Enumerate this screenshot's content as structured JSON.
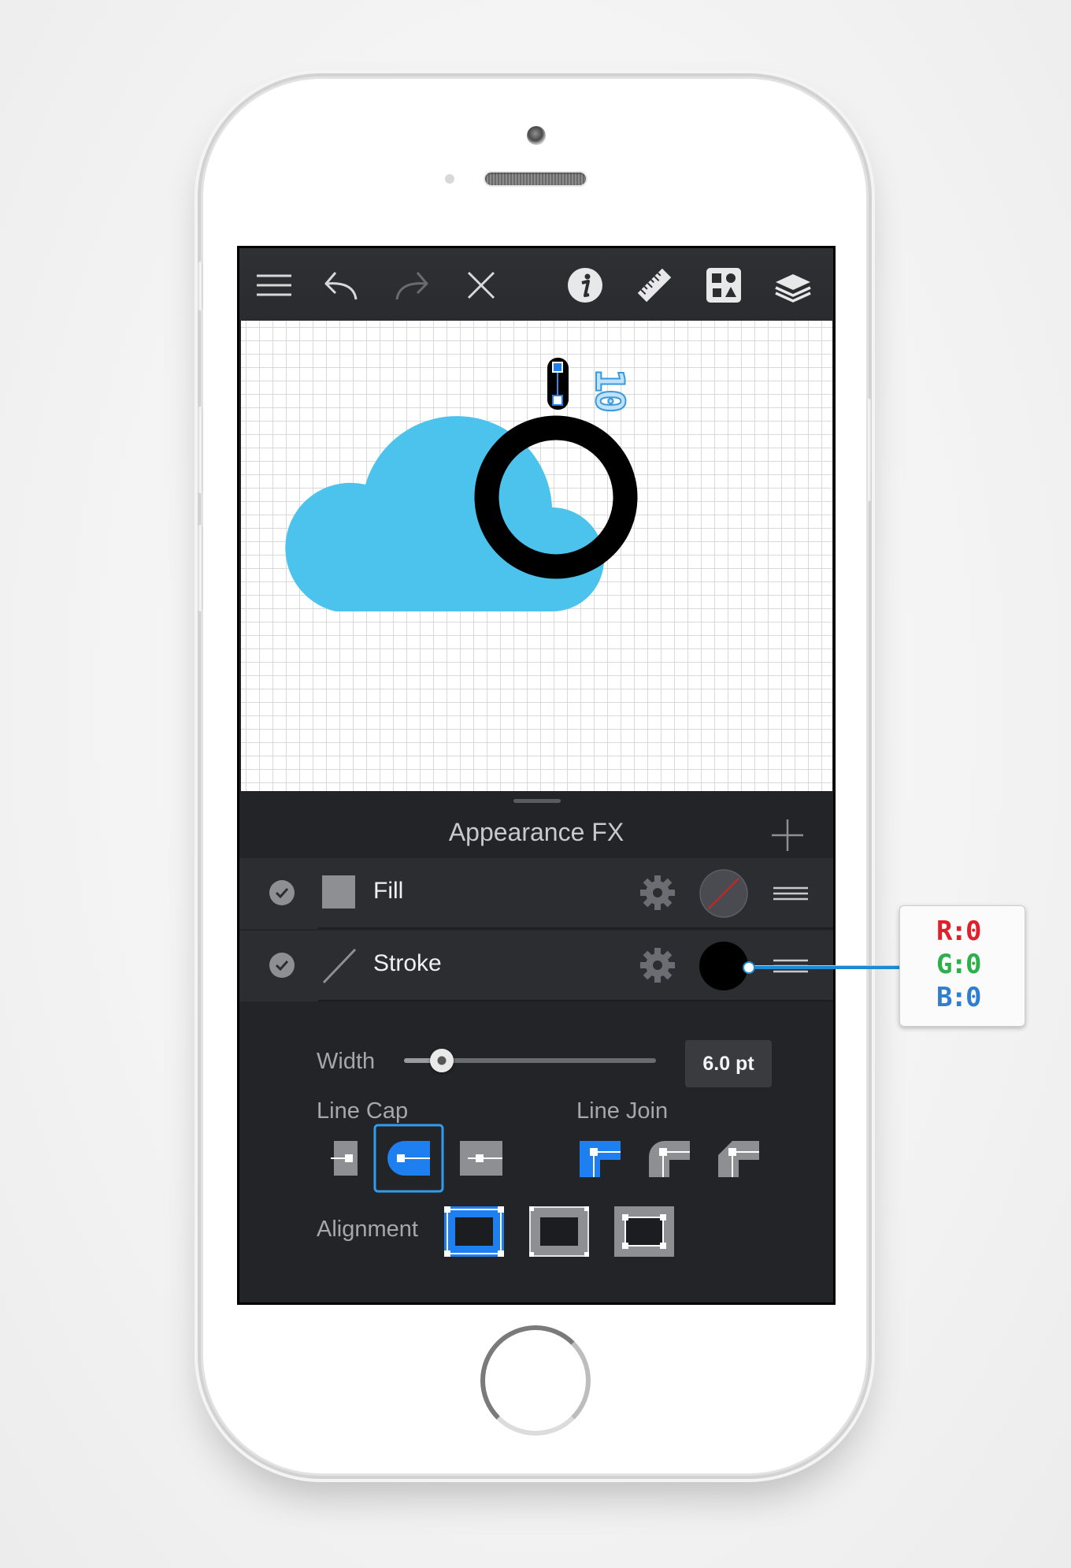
{
  "colors": {
    "accent": "#1e7ff0",
    "cloud": "#4bc3ec",
    "stroke_swatch": "#000000",
    "annotation_blue": "#3a9ad9",
    "rgb_r": "#e0202a",
    "rgb_g": "#2cb14a",
    "rgb_b": "#2f7fd0"
  },
  "toolbar": {
    "icons": [
      "menu-icon",
      "undo-icon",
      "redo-icon",
      "close-icon",
      "info-icon",
      "ruler-icon",
      "shapes-icon",
      "layers-icon"
    ]
  },
  "canvas": {
    "annotation_label": "10"
  },
  "panel": {
    "title": "Appearance FX",
    "rows": [
      {
        "label": "Fill",
        "enabled": true
      },
      {
        "label": "Stroke",
        "enabled": true
      }
    ],
    "width": {
      "label": "Width",
      "value": "6.0 pt",
      "slider_fraction": 0.15
    },
    "line_cap": {
      "label": "Line Cap",
      "options": [
        "butt-cap",
        "round-cap",
        "square-cap"
      ],
      "selected": "round-cap"
    },
    "line_join": {
      "label": "Line Join",
      "options": [
        "miter-join",
        "round-join",
        "bevel-join"
      ],
      "selected": "miter-join"
    },
    "alignment": {
      "label": "Alignment",
      "options": [
        "align-inside",
        "align-center",
        "align-outside"
      ],
      "selected": "align-inside"
    }
  },
  "callout": {
    "r": "R:0",
    "g": "G:0",
    "b": "B:0"
  }
}
